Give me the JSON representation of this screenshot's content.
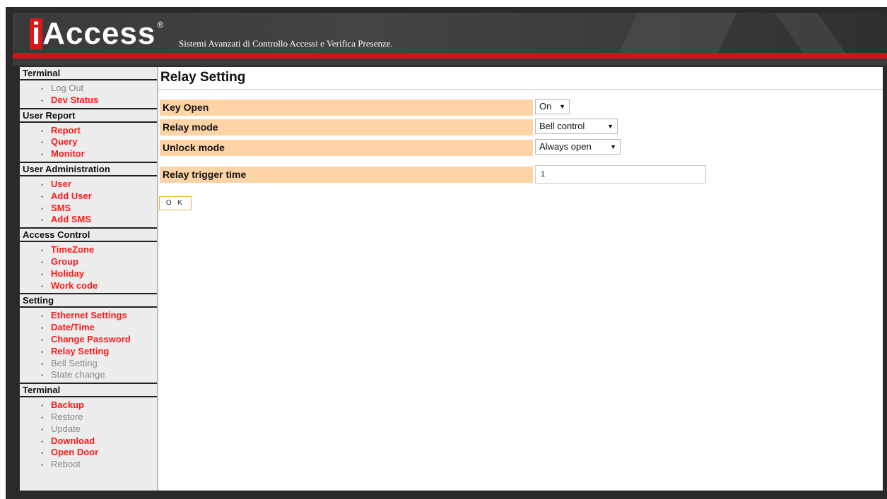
{
  "header": {
    "logo_i": "i",
    "logo_rest": "Access",
    "logo_reg": "®",
    "tagline": "Sistemi Avanzati di Controllo Accessi e Verifica Presenze."
  },
  "sidebar": {
    "sections": [
      {
        "title": "Terminal",
        "items": [
          {
            "label": "Log Out",
            "state": "inactive"
          },
          {
            "label": "Dev Status",
            "state": "active"
          }
        ]
      },
      {
        "title": "User Report",
        "items": [
          {
            "label": "Report",
            "state": "active"
          },
          {
            "label": "Query",
            "state": "active"
          },
          {
            "label": "Monitor",
            "state": "active"
          }
        ]
      },
      {
        "title": "User Administration",
        "items": [
          {
            "label": "User",
            "state": "active"
          },
          {
            "label": "Add User",
            "state": "active"
          },
          {
            "label": "SMS",
            "state": "active"
          },
          {
            "label": "Add SMS",
            "state": "active"
          }
        ]
      },
      {
        "title": "Access Control",
        "items": [
          {
            "label": "TimeZone",
            "state": "active"
          },
          {
            "label": "Group",
            "state": "active"
          },
          {
            "label": "Holiday",
            "state": "active"
          },
          {
            "label": "Work code",
            "state": "active"
          }
        ]
      },
      {
        "title": "Setting",
        "items": [
          {
            "label": "Ethernet Settings",
            "state": "active"
          },
          {
            "label": "Date/Time",
            "state": "active"
          },
          {
            "label": "Change Password",
            "state": "active"
          },
          {
            "label": "Relay Setting",
            "state": "active"
          },
          {
            "label": "Bell Setting",
            "state": "inactive"
          },
          {
            "label": "State change",
            "state": "inactive"
          }
        ]
      },
      {
        "title": "Terminal",
        "items": [
          {
            "label": "Backup",
            "state": "active"
          },
          {
            "label": "Restore",
            "state": "inactive"
          },
          {
            "label": "Update",
            "state": "inactive"
          },
          {
            "label": "Download",
            "state": "active"
          },
          {
            "label": "Open Door",
            "state": "active"
          },
          {
            "label": "Reboot",
            "state": "inactive"
          }
        ]
      }
    ]
  },
  "main": {
    "title": "Relay Setting",
    "key_open": {
      "label": "Key Open",
      "value": "On"
    },
    "relay_mode": {
      "label": "Relay mode",
      "value": "Bell control"
    },
    "unlock_mode": {
      "label": "Unlock mode",
      "value": "Always open"
    },
    "relay_trigger_time": {
      "label": "Relay trigger time",
      "value": "1"
    },
    "ok_label": "O K"
  },
  "colors": {
    "accent_red": "#c8161b",
    "link_active": "#ff1a1a",
    "link_inactive": "#8a8a8a",
    "label_bg": "#fed4a6",
    "button_border": "#f0b24a"
  }
}
